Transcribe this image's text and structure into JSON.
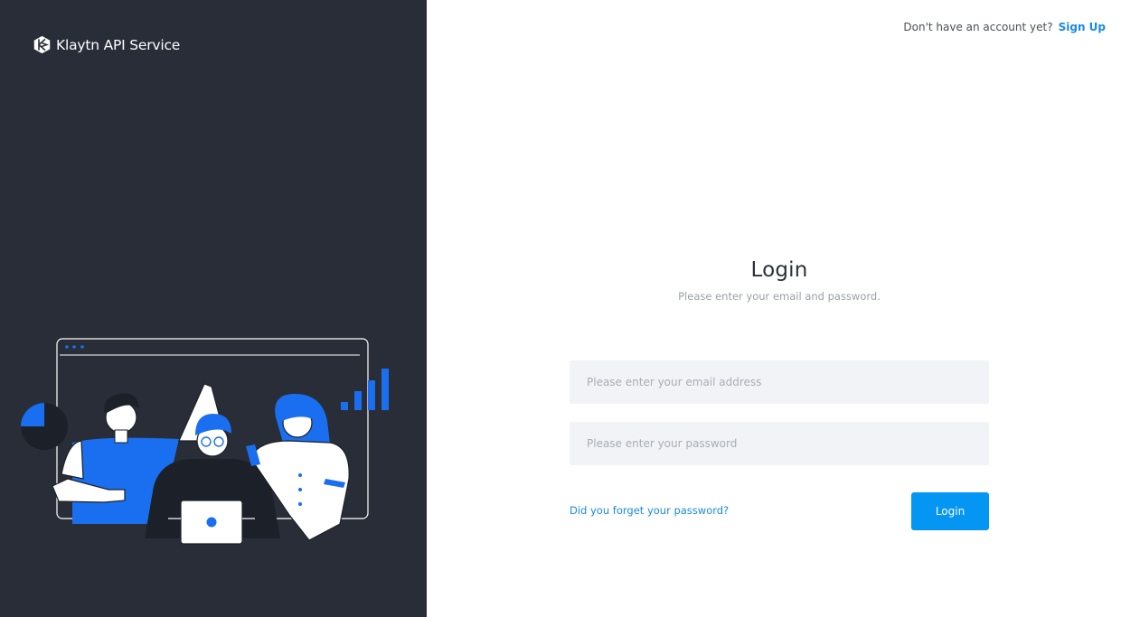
{
  "brand": {
    "name": "Klaytn API Service",
    "logo_icon": "klaytn-logo-icon"
  },
  "header": {
    "signup_prompt": "Don't have an account yet?",
    "signup_link": "Sign Up"
  },
  "login": {
    "title": "Login",
    "subtitle": "Please enter your email and password.",
    "email_placeholder": "Please enter your email address",
    "email_value": "",
    "password_placeholder": "Please enter your password",
    "password_value": "",
    "forgot_link": "Did you forget your password?",
    "submit_label": "Login"
  },
  "illustration": {
    "icon": "team-high-five-illustration"
  },
  "colors": {
    "left_panel_bg": "#282d37",
    "accent": "#0595f2",
    "link": "#1a8ae6",
    "input_bg": "#f1f3f6",
    "illustration_blue": "#1a6ff0"
  }
}
